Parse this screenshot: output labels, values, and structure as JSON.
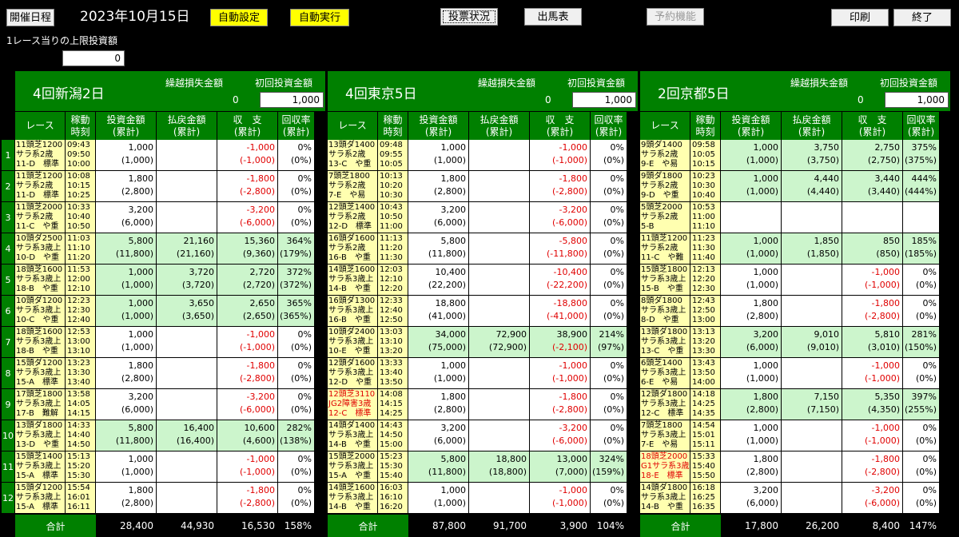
{
  "toolbar": {
    "schedule": "開催日程",
    "date": "2023年10月15日",
    "auto_set": "自動設定",
    "auto_exec": "自動実行",
    "vote_status": "投票状況",
    "race_card": "出馬表",
    "reserve": "予約機能",
    "print": "印刷",
    "exit": "終了"
  },
  "limit": {
    "label": "1レース当りの上限投資額",
    "value": "0"
  },
  "venues": [
    {
      "name": "4回新潟2日",
      "carry_label": "繰越損失金額",
      "carry_value": "0",
      "init_label": "初回投資金額",
      "init_value": "1,000"
    },
    {
      "name": "4回東京5日",
      "carry_label": "繰越損失金額",
      "carry_value": "0",
      "init_label": "初回投資金額",
      "init_value": "1,000"
    },
    {
      "name": "2回京都5日",
      "carry_label": "繰越損失金額",
      "carry_value": "0",
      "init_label": "初回投資金額",
      "init_value": "1,000"
    }
  ],
  "col_headers": {
    "race": "レース",
    "time1": "稼動",
    "time2": "時刻",
    "inv1": "投資金額",
    "inv2": "(累計)",
    "pay1": "払戻金額",
    "pay2": "(累計)",
    "bal1": "収　支",
    "bal2": "(累計)",
    "rate1": "回収率",
    "rate2": "(累計)"
  },
  "row_numbers": [
    "1",
    "2",
    "3",
    "4",
    "5",
    "6",
    "7",
    "8",
    "9",
    "10",
    "11",
    "12"
  ],
  "races": [
    [
      {
        "r1": "11頭芝1200",
        "r2": "サラ系2歳",
        "r3": "11-D　標準",
        "t1": "09:43",
        "t2": "09:50",
        "t3": "10:00",
        "inv": "1,000",
        "invc": "(1,000)",
        "pay": "",
        "payc": "",
        "bal": "-1,000",
        "balc": "(-1,000)",
        "rate": "0%",
        "ratec": "(0%)",
        "g": false,
        "neg": true
      },
      {
        "r1": "11頭芝1200",
        "r2": "サラ系2歳",
        "r3": "11-D　標準",
        "t1": "10:08",
        "t2": "10:15",
        "t3": "10:25",
        "inv": "1,800",
        "invc": "(2,800)",
        "pay": "",
        "payc": "",
        "bal": "-1,800",
        "balc": "(-2,800)",
        "rate": "0%",
        "ratec": "(0%)",
        "g": false,
        "neg": true
      },
      {
        "r1": "11頭芝2000",
        "r2": "サラ系2歳",
        "r3": "11-C　や重",
        "t1": "10:33",
        "t2": "10:40",
        "t3": "10:50",
        "inv": "3,200",
        "invc": "(6,000)",
        "pay": "",
        "payc": "",
        "bal": "-3,200",
        "balc": "(-6,000)",
        "rate": "0%",
        "ratec": "(0%)",
        "g": false,
        "neg": true
      },
      {
        "r1": "10頭ダ2500",
        "r2": "サラ系3歳上",
        "r3": "10-D　や重",
        "t1": "11:03",
        "t2": "11:10",
        "t3": "11:20",
        "inv": "5,800",
        "invc": "(11,800)",
        "pay": "21,160",
        "payc": "(21,160)",
        "bal": "15,360",
        "balc": "(9,360)",
        "rate": "364%",
        "ratec": "(179%)",
        "g": true,
        "neg": false
      },
      {
        "r1": "18頭芝1600",
        "r2": "サラ系3歳上",
        "r3": "18-B　や重",
        "t1": "11:53",
        "t2": "12:00",
        "t3": "12:10",
        "inv": "1,000",
        "invc": "(1,000)",
        "pay": "3,720",
        "payc": "(3,720)",
        "bal": "2,720",
        "balc": "(2,720)",
        "rate": "372%",
        "ratec": "(372%)",
        "g": true,
        "neg": false
      },
      {
        "r1": "10頭ダ1200",
        "r2": "サラ系3歳上",
        "r3": "10-C　や重",
        "t1": "12:23",
        "t2": "12:30",
        "t3": "12:40",
        "inv": "1,000",
        "invc": "(1,000)",
        "pay": "3,650",
        "payc": "(3,650)",
        "bal": "2,650",
        "balc": "(2,650)",
        "rate": "365%",
        "ratec": "(365%)",
        "g": true,
        "neg": false
      },
      {
        "r1": "18頭芝1600",
        "r2": "サラ系3歳上",
        "r3": "18-B　や重",
        "t1": "12:53",
        "t2": "13:00",
        "t3": "13:10",
        "inv": "1,000",
        "invc": "(1,000)",
        "pay": "",
        "payc": "",
        "bal": "-1,000",
        "balc": "(-1,000)",
        "rate": "0%",
        "ratec": "(0%)",
        "g": false,
        "neg": true
      },
      {
        "r1": "15頭ダ1200",
        "r2": "サラ系3歳上",
        "r3": "15-A　標準",
        "t1": "13:23",
        "t2": "13:30",
        "t3": "13:40",
        "inv": "1,800",
        "invc": "(2,800)",
        "pay": "",
        "payc": "",
        "bal": "-1,800",
        "balc": "(-2,800)",
        "rate": "0%",
        "ratec": "(0%)",
        "g": false,
        "neg": true
      },
      {
        "r1": "17頭芝1800",
        "r2": "サラ系3歳上",
        "r3": "17-B　難解",
        "t1": "13:58",
        "t2": "14:05",
        "t3": "14:15",
        "inv": "3,200",
        "invc": "(6,000)",
        "pay": "",
        "payc": "",
        "bal": "-3,200",
        "balc": "(-6,000)",
        "rate": "0%",
        "ratec": "(0%)",
        "g": false,
        "neg": true
      },
      {
        "r1": "13頭ダ1800",
        "r2": "サラ系3歳上",
        "r3": "13-D　や重",
        "t1": "14:33",
        "t2": "14:40",
        "t3": "14:50",
        "inv": "5,800",
        "invc": "(11,800)",
        "pay": "16,400",
        "payc": "(16,400)",
        "bal": "10,600",
        "balc": "(4,600)",
        "rate": "282%",
        "ratec": "(138%)",
        "g": true,
        "neg": false
      },
      {
        "r1": "15頭芝1400",
        "r2": "サラ系3歳上",
        "r3": "15-A　標準",
        "t1": "15:13",
        "t2": "15:20",
        "t3": "15:30",
        "inv": "1,000",
        "invc": "(1,000)",
        "pay": "",
        "payc": "",
        "bal": "-1,000",
        "balc": "(-1,000)",
        "rate": "0%",
        "ratec": "(0%)",
        "g": false,
        "neg": true
      },
      {
        "r1": "15頭ダ1200",
        "r2": "サラ系3歳上",
        "r3": "15-A　標準",
        "t1": "15:54",
        "t2": "16:01",
        "t3": "16:11",
        "inv": "1,800",
        "invc": "(2,800)",
        "pay": "",
        "payc": "",
        "bal": "-1,800",
        "balc": "(-2,800)",
        "rate": "0%",
        "ratec": "(0%)",
        "g": false,
        "neg": true
      }
    ],
    [
      {
        "r1": "13頭ダ1400",
        "r2": "サラ系2歳",
        "r3": "13-C　や重",
        "t1": "09:48",
        "t2": "09:55",
        "t3": "10:05",
        "inv": "1,000",
        "invc": "(1,000)",
        "pay": "",
        "payc": "",
        "bal": "-1,000",
        "balc": "(-1,000)",
        "rate": "0%",
        "ratec": "(0%)",
        "g": false,
        "neg": true
      },
      {
        "r1": "7頭芝1800",
        "r2": "サラ系2歳",
        "r3": "7-E　や易",
        "t1": "10:13",
        "t2": "10:20",
        "t3": "10:30",
        "inv": "1,800",
        "invc": "(2,800)",
        "pay": "",
        "payc": "",
        "bal": "-1,800",
        "balc": "(-2,800)",
        "rate": "0%",
        "ratec": "(0%)",
        "g": false,
        "neg": true
      },
      {
        "r1": "12頭芝1400",
        "r2": "サラ系2歳",
        "r3": "12-D　標準",
        "t1": "10:43",
        "t2": "10:50",
        "t3": "11:00",
        "inv": "3,200",
        "invc": "(6,000)",
        "pay": "",
        "payc": "",
        "bal": "-3,200",
        "balc": "(-6,000)",
        "rate": "0%",
        "ratec": "(0%)",
        "g": false,
        "neg": true
      },
      {
        "r1": "16頭ダ1600",
        "r2": "サラ系2歳",
        "r3": "16-B　や重",
        "t1": "11:13",
        "t2": "11:20",
        "t3": "11:30",
        "inv": "5,800",
        "invc": "(11,800)",
        "pay": "",
        "payc": "",
        "bal": "-5,800",
        "balc": "(-11,800)",
        "rate": "0%",
        "ratec": "(0%)",
        "g": false,
        "neg": true
      },
      {
        "r1": "14頭芝1600",
        "r2": "サラ系3歳上",
        "r3": "14-B　や重",
        "t1": "12:03",
        "t2": "12:10",
        "t3": "12:20",
        "inv": "10,400",
        "invc": "(22,200)",
        "pay": "",
        "payc": "",
        "bal": "-10,400",
        "balc": "(-22,200)",
        "rate": "0%",
        "ratec": "(0%)",
        "g": false,
        "neg": true
      },
      {
        "r1": "16頭ダ1300",
        "r2": "サラ系3歳上",
        "r3": "16-B　や重",
        "t1": "12:33",
        "t2": "12:40",
        "t3": "12:50",
        "inv": "18,800",
        "invc": "(41,000)",
        "pay": "",
        "payc": "",
        "bal": "-18,800",
        "balc": "(-41,000)",
        "rate": "0%",
        "ratec": "(0%)",
        "g": false,
        "neg": true
      },
      {
        "r1": "10頭ダ2400",
        "r2": "サラ系3歳上",
        "r3": "10-E　や重",
        "t1": "13:03",
        "t2": "13:10",
        "t3": "13:20",
        "inv": "34,000",
        "invc": "(75,000)",
        "pay": "72,900",
        "payc": "(72,900)",
        "bal": "38,900",
        "balc": "(-2,100)",
        "rate": "214%",
        "ratec": "(97%)",
        "g": true,
        "neg": false,
        "negc": true
      },
      {
        "r1": "12頭ダ1600",
        "r2": "サラ系3歳上",
        "r3": "12-D　や重",
        "t1": "13:33",
        "t2": "13:40",
        "t3": "13:50",
        "inv": "1,000",
        "invc": "(1,000)",
        "pay": "",
        "payc": "",
        "bal": "-1,000",
        "balc": "(-1,000)",
        "rate": "0%",
        "ratec": "(0%)",
        "g": false,
        "neg": true
      },
      {
        "r1": "12頭芝3110",
        "r2": "JG2障害3歳",
        "r3": "12-C　標準",
        "t1": "14:08",
        "t2": "14:15",
        "t3": "14:25",
        "inv": "1,800",
        "invc": "(2,800)",
        "pay": "",
        "payc": "",
        "bal": "-1,800",
        "balc": "(-2,800)",
        "rate": "0%",
        "ratec": "(0%)",
        "g": false,
        "neg": true,
        "red": true
      },
      {
        "r1": "14頭ダ1400",
        "r2": "サラ系3歳上",
        "r3": "14-B　や重",
        "t1": "14:43",
        "t2": "14:50",
        "t3": "15:00",
        "inv": "3,200",
        "invc": "(6,000)",
        "pay": "",
        "payc": "",
        "bal": "-3,200",
        "balc": "(-6,000)",
        "rate": "0%",
        "ratec": "(0%)",
        "g": false,
        "neg": true
      },
      {
        "r1": "15頭芝2000",
        "r2": "サラ系3歳上",
        "r3": "15-A　や重",
        "t1": "15:23",
        "t2": "15:30",
        "t3": "15:40",
        "inv": "5,800",
        "invc": "(11,800)",
        "pay": "18,800",
        "payc": "(18,800)",
        "bal": "13,000",
        "balc": "(7,000)",
        "rate": "324%",
        "ratec": "(159%)",
        "g": true,
        "neg": false
      },
      {
        "r1": "14頭芝1600",
        "r2": "サラ系3歳上",
        "r3": "14-B　や重",
        "t1": "16:03",
        "t2": "16:10",
        "t3": "16:20",
        "inv": "1,000",
        "invc": "(1,000)",
        "pay": "",
        "payc": "",
        "bal": "-1,000",
        "balc": "(-1,000)",
        "rate": "0%",
        "ratec": "(0%)",
        "g": false,
        "neg": true
      }
    ],
    [
      {
        "r1": "9頭ダ1400",
        "r2": "サラ系2歳",
        "r3": "9-E　や易",
        "t1": "09:58",
        "t2": "10:05",
        "t3": "10:15",
        "inv": "1,000",
        "invc": "(1,000)",
        "pay": "3,750",
        "payc": "(3,750)",
        "bal": "2,750",
        "balc": "(2,750)",
        "rate": "375%",
        "ratec": "(375%)",
        "g": true,
        "neg": false
      },
      {
        "r1": "9頭ダ1800",
        "r2": "サラ系2歳",
        "r3": "9-D　や重",
        "t1": "10:23",
        "t2": "10:30",
        "t3": "10:40",
        "inv": "1,000",
        "invc": "(1,000)",
        "pay": "4,440",
        "payc": "(4,440)",
        "bal": "3,440",
        "balc": "(3,440)",
        "rate": "444%",
        "ratec": "(444%)",
        "g": true,
        "neg": false
      },
      {
        "r1": "5頭芝2000",
        "r2": "サラ系2歳",
        "r3": "5-B",
        "t1": "10:53",
        "t2": "11:00",
        "t3": "11:10",
        "inv": "",
        "invc": "",
        "pay": "",
        "payc": "",
        "bal": "",
        "balc": "",
        "rate": "",
        "ratec": "",
        "g": false,
        "neg": false
      },
      {
        "r1": "11頭芝1200",
        "r2": "サラ系2歳",
        "r3": "11-C　や難",
        "t1": "11:23",
        "t2": "11:30",
        "t3": "11:40",
        "inv": "1,000",
        "invc": "(1,000)",
        "pay": "1,850",
        "payc": "(1,850)",
        "bal": "850",
        "balc": "(850)",
        "rate": "185%",
        "ratec": "(185%)",
        "g": true,
        "neg": false
      },
      {
        "r1": "15頭芝1800",
        "r2": "サラ系3歳上",
        "r3": "15-B　や重",
        "t1": "12:13",
        "t2": "12:20",
        "t3": "12:30",
        "inv": "1,000",
        "invc": "(1,000)",
        "pay": "",
        "payc": "",
        "bal": "-1,000",
        "balc": "(-1,000)",
        "rate": "0%",
        "ratec": "(0%)",
        "g": false,
        "neg": true
      },
      {
        "r1": "8頭ダ1800",
        "r2": "サラ系3歳上",
        "r3": "8-D　や重",
        "t1": "12:43",
        "t2": "12:50",
        "t3": "13:00",
        "inv": "1,800",
        "invc": "(2,800)",
        "pay": "",
        "payc": "",
        "bal": "-1,800",
        "balc": "(-2,800)",
        "rate": "0%",
        "ratec": "(0%)",
        "g": false,
        "neg": true
      },
      {
        "r1": "13頭ダ1800",
        "r2": "サラ系3歳上",
        "r3": "13-C　や重",
        "t1": "13:13",
        "t2": "13:20",
        "t3": "13:30",
        "inv": "3,200",
        "invc": "(6,000)",
        "pay": "9,010",
        "payc": "(9,010)",
        "bal": "5,810",
        "balc": "(3,010)",
        "rate": "281%",
        "ratec": "(150%)",
        "g": true,
        "neg": false
      },
      {
        "r1": "6頭芝1400",
        "r2": "サラ系3歳上",
        "r3": "6-E　や易",
        "t1": "13:43",
        "t2": "13:50",
        "t3": "14:00",
        "inv": "1,000",
        "invc": "(1,000)",
        "pay": "",
        "payc": "",
        "bal": "-1,000",
        "balc": "(-1,000)",
        "rate": "0%",
        "ratec": "(0%)",
        "g": false,
        "neg": true
      },
      {
        "r1": "12頭ダ1800",
        "r2": "サラ系3歳上",
        "r3": "12-C　標準",
        "t1": "14:18",
        "t2": "14:25",
        "t3": "14:35",
        "inv": "1,800",
        "invc": "(2,800)",
        "pay": "7,150",
        "payc": "(7,150)",
        "bal": "5,350",
        "balc": "(4,350)",
        "rate": "397%",
        "ratec": "(255%)",
        "g": true,
        "neg": false
      },
      {
        "r1": "7頭芝1800",
        "r2": "サラ系3歳上",
        "r3": "7-E　や易",
        "t1": "14:54",
        "t2": "15:01",
        "t3": "15:11",
        "inv": "1,000",
        "invc": "(1,000)",
        "pay": "",
        "payc": "",
        "bal": "-1,000",
        "balc": "(-1,000)",
        "rate": "0%",
        "ratec": "(0%)",
        "g": false,
        "neg": true
      },
      {
        "r1": "18頭芝2000",
        "r2": "G1サラ系3歳",
        "r3": "18-E　標準",
        "t1": "15:33",
        "t2": "15:40",
        "t3": "15:50",
        "inv": "1,800",
        "invc": "(2,800)",
        "pay": "",
        "payc": "",
        "bal": "-1,800",
        "balc": "(-2,800)",
        "rate": "0%",
        "ratec": "(0%)",
        "g": false,
        "neg": true,
        "red": true
      },
      {
        "r1": "14頭ダ1800",
        "r2": "サラ系3歳上",
        "r3": "14-B　や重",
        "t1": "16:18",
        "t2": "16:25",
        "t3": "16:35",
        "inv": "3,200",
        "invc": "(6,000)",
        "pay": "",
        "payc": "",
        "bal": "-3,200",
        "balc": "(-6,000)",
        "rate": "0%",
        "ratec": "(0%)",
        "g": false,
        "neg": true
      }
    ]
  ],
  "totals": [
    {
      "label": "合計",
      "inv": "28,400",
      "pay": "44,930",
      "bal": "16,530",
      "rate": "158%"
    },
    {
      "label": "合計",
      "inv": "87,800",
      "pay": "91,700",
      "bal": "3,900",
      "rate": "104%"
    },
    {
      "label": "合計",
      "inv": "17,800",
      "pay": "26,200",
      "bal": "8,400",
      "rate": "147%"
    }
  ],
  "colors": {
    "green": "#008000",
    "light_green": "#ccf5cc",
    "yellow": "#ffff00",
    "race_bg": "#ffffb0",
    "negative": "#e00000"
  }
}
